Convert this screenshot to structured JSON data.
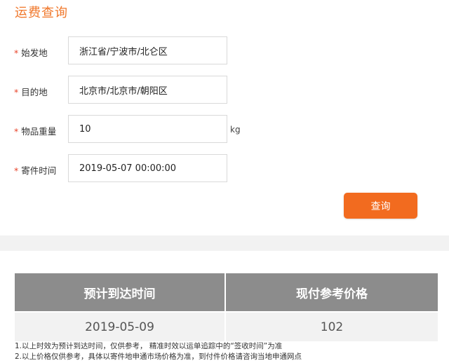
{
  "page": {
    "title": "运费查询"
  },
  "form": {
    "required_mark": "*",
    "origin": {
      "label": "始发地",
      "value": "浙江省/宁波市/北仑区"
    },
    "destination": {
      "label": "目的地",
      "value": "北京市/北京市/朝阳区"
    },
    "weight": {
      "label": "物品重量",
      "value": "10",
      "unit": "kg"
    },
    "send_time": {
      "label": "寄件时间",
      "value": "2019-05-07 00:00:00"
    },
    "query_label": "查询"
  },
  "result": {
    "headers": [
      "预计到达时间",
      "现付参考价格"
    ],
    "row": [
      "2019-05-09",
      "102"
    ]
  },
  "notes": [
    "1.以上时效为预计到达时间，仅供参考， 精准时效以运单追踪中的“签收时间”为准",
    "2.以上价格仅供参考，具体以寄件地申通市场价格为准，到付件价格请咨询当地申通网点"
  ],
  "colors": {
    "accent": "#f0772a",
    "button": "#f26b1f",
    "required": "#e8442a",
    "table_header": "#8c8c8c"
  }
}
